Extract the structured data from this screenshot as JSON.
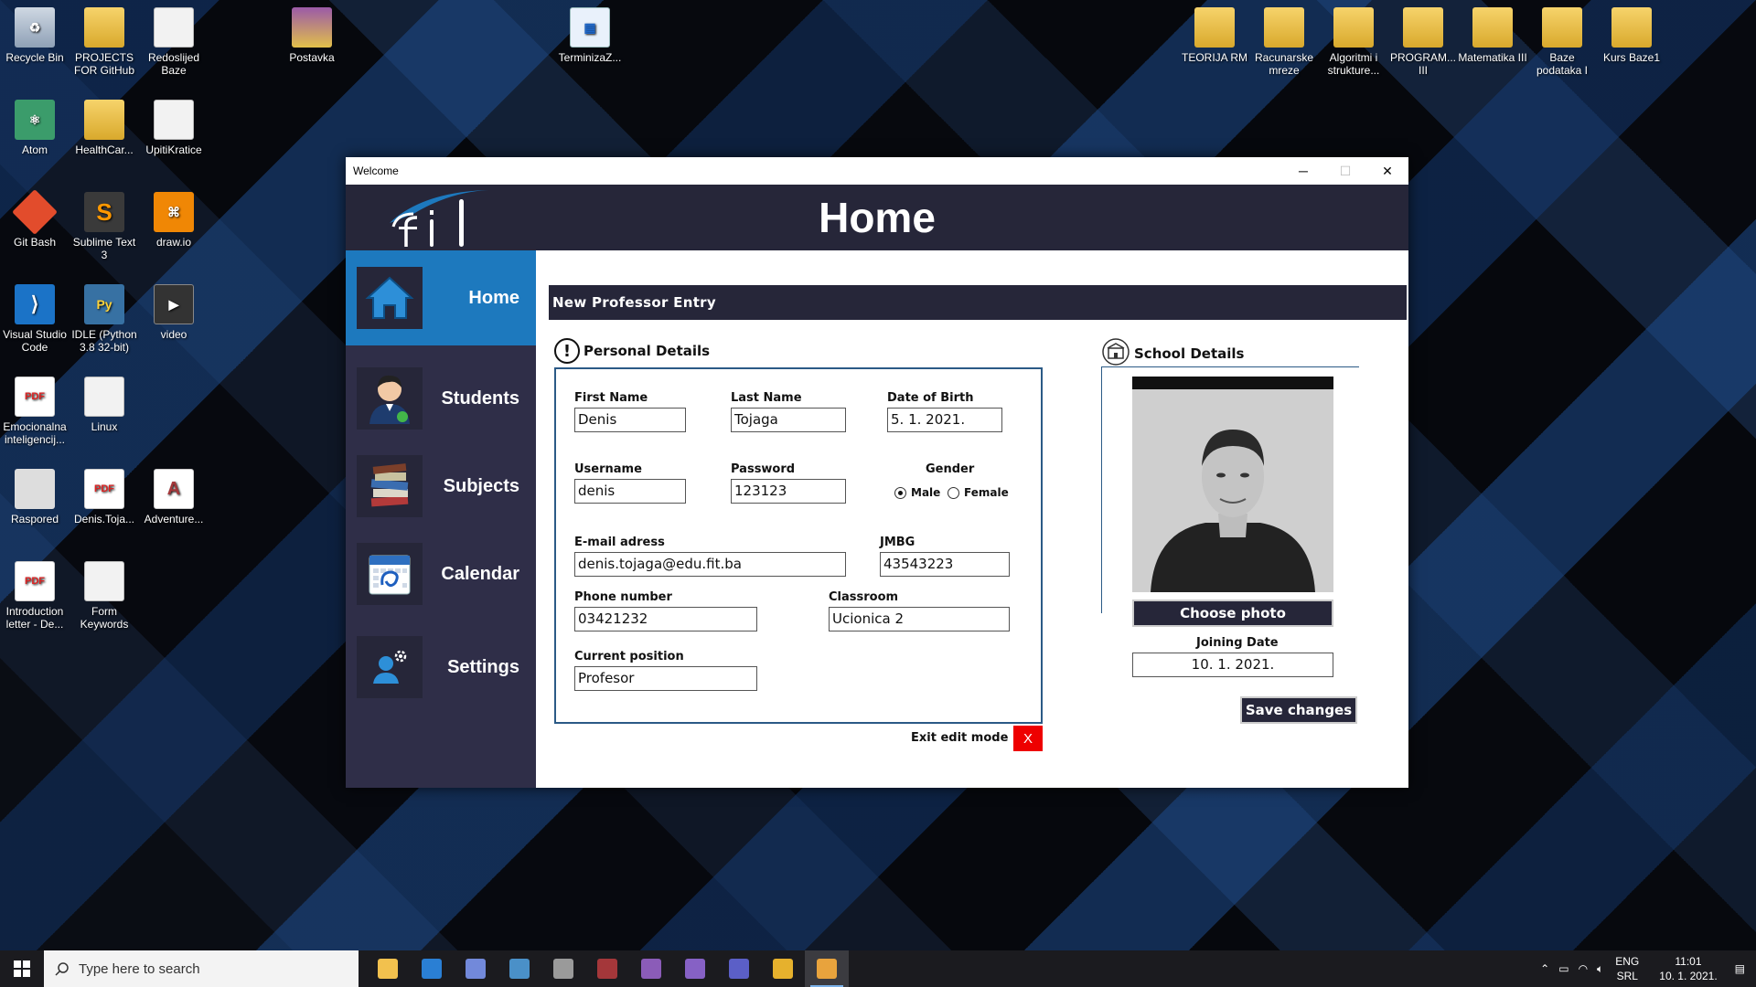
{
  "desktop": {
    "icons": [
      {
        "label": "Recycle Bin",
        "icon": "recycle-bin-icon"
      },
      {
        "label": "PROJECTS FOR GitHub",
        "icon": "folder-icon"
      },
      {
        "label": "Redoslijed Baze",
        "icon": "document-icon"
      },
      {
        "label": "Postavka",
        "icon": "rar-icon"
      },
      {
        "label": "TerminizaZ...",
        "icon": "calendar-file-icon"
      },
      {
        "label": "TEORIJA RM",
        "icon": "folder-icon"
      },
      {
        "label": "Racunarske mreze",
        "icon": "folder-icon"
      },
      {
        "label": "Algoritmi i strukture...",
        "icon": "folder-icon"
      },
      {
        "label": "PROGRAM... III",
        "icon": "folder-icon"
      },
      {
        "label": "Matematika III",
        "icon": "folder-icon"
      },
      {
        "label": "Baze podataka I",
        "icon": "folder-icon"
      },
      {
        "label": "Kurs Baze1",
        "icon": "folder-icon"
      },
      {
        "label": "Atom",
        "icon": "atom-icon"
      },
      {
        "label": "HealthCar...",
        "icon": "folder-icon"
      },
      {
        "label": "UpitiKratice",
        "icon": "document-icon"
      },
      {
        "label": "Git Bash",
        "icon": "git-icon"
      },
      {
        "label": "Sublime Text 3",
        "icon": "sublime-icon"
      },
      {
        "label": "draw.io",
        "icon": "drawio-icon"
      },
      {
        "label": "Visual Studio Code",
        "icon": "vscode-icon"
      },
      {
        "label": "IDLE (Python 3.8 32-bit)",
        "icon": "python-icon"
      },
      {
        "label": "video",
        "icon": "video-icon"
      },
      {
        "label": "Emocionalna inteligencij...",
        "icon": "pdf-icon"
      },
      {
        "label": "Linux",
        "icon": "document-icon"
      },
      {
        "label": "Raspored",
        "icon": "schedule-icon"
      },
      {
        "label": "Denis.Toja...",
        "icon": "pdf-icon"
      },
      {
        "label": "Adventure...",
        "icon": "access-icon"
      },
      {
        "label": "Introduction letter - De...",
        "icon": "pdf-icon"
      },
      {
        "label": "Form Keywords",
        "icon": "document-icon"
      }
    ]
  },
  "window": {
    "title": "Welcome",
    "controls": {
      "minimize": "─",
      "maximize": "☐",
      "close": "✕"
    },
    "header_title": "Home"
  },
  "sidebar": {
    "items": [
      {
        "label": "Home",
        "icon": "home-icon",
        "active": true
      },
      {
        "label": "Students",
        "icon": "student-icon",
        "active": false
      },
      {
        "label": "Subjects",
        "icon": "books-icon",
        "active": false
      },
      {
        "label": "Calendar",
        "icon": "calendar-icon",
        "active": false
      },
      {
        "label": "Settings",
        "icon": "user-settings-icon",
        "active": false
      }
    ]
  },
  "form": {
    "section_title": "New Professor Entry",
    "personal_heading": "Personal Details",
    "school_heading": "School Details",
    "first_name": {
      "label": "First Name",
      "value": "Denis"
    },
    "last_name": {
      "label": "Last Name",
      "value": "Tojaga"
    },
    "dob": {
      "label": "Date of Birth",
      "value": "5. 1. 2021."
    },
    "username": {
      "label": "Username",
      "value": "denis"
    },
    "password": {
      "label": "Password",
      "value": "123123"
    },
    "gender": {
      "label": "Gender",
      "options": [
        "Male",
        "Female"
      ],
      "selected": "Male"
    },
    "email": {
      "label": "E-mail adress",
      "value": "denis.tojaga@edu.fit.ba"
    },
    "jmbg": {
      "label": "JMBG",
      "value": "43543223"
    },
    "phone": {
      "label": "Phone number",
      "value": "03421232"
    },
    "classroom": {
      "label": "Classroom",
      "value": "Ucionica 2"
    },
    "position": {
      "label": "Current position",
      "value": "Profesor"
    },
    "choose_photo": "Choose photo",
    "joining_date": {
      "label": "Joining Date",
      "value": "10. 1. 2021."
    },
    "save_changes": "Save changes",
    "exit_edit": "Exit edit mode",
    "exit_x": "X"
  },
  "taskbar": {
    "search_placeholder": "Type here to search",
    "apps": [
      {
        "icon": "file-explorer-icon",
        "color": "#f2c14e"
      },
      {
        "icon": "mail-icon",
        "color": "#2a7fd4"
      },
      {
        "icon": "discord-icon",
        "color": "#7289da"
      },
      {
        "icon": "sourcetree-icon",
        "color": "#4a90c8"
      },
      {
        "icon": "database-icon",
        "color": "#9a9a9a"
      },
      {
        "icon": "access-icon",
        "color": "#a4373a"
      },
      {
        "icon": "eclipse-icon",
        "color": "#8b5cb8"
      },
      {
        "icon": "visual-studio-icon",
        "color": "#8661c5"
      },
      {
        "icon": "teams-icon",
        "color": "#5b5fc7"
      },
      {
        "icon": "chrome-icon",
        "color": "#e6b12d"
      },
      {
        "icon": "winforms-app-icon",
        "color": "#e8a33d"
      }
    ],
    "lang_top": "ENG",
    "lang_bottom": "SRL",
    "time": "11:01",
    "date": "10. 1. 2021."
  }
}
